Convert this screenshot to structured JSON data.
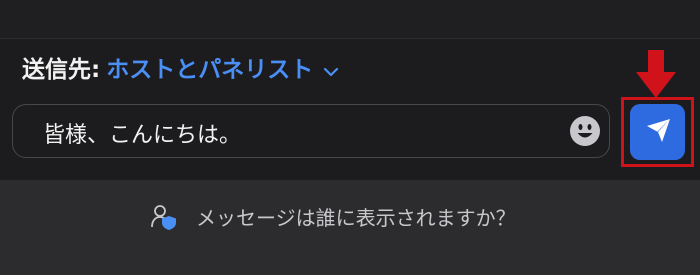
{
  "header": {
    "recipient_label": "送信先:",
    "recipient_value": "ホストとパネリスト"
  },
  "composer": {
    "message": "皆様、こんにちは。"
  },
  "footer": {
    "question": "メッセージは誰に表示されますか？"
  },
  "icons": {
    "chevron": "chevron-down-icon",
    "emoji": "emoji-icon",
    "send": "send-icon",
    "arrow": "arrow-down-icon",
    "visibility": "user-shield-icon"
  },
  "colors": {
    "accent": "#4a8ff5",
    "send_button": "#2f6be0",
    "highlight": "#d0121b"
  }
}
